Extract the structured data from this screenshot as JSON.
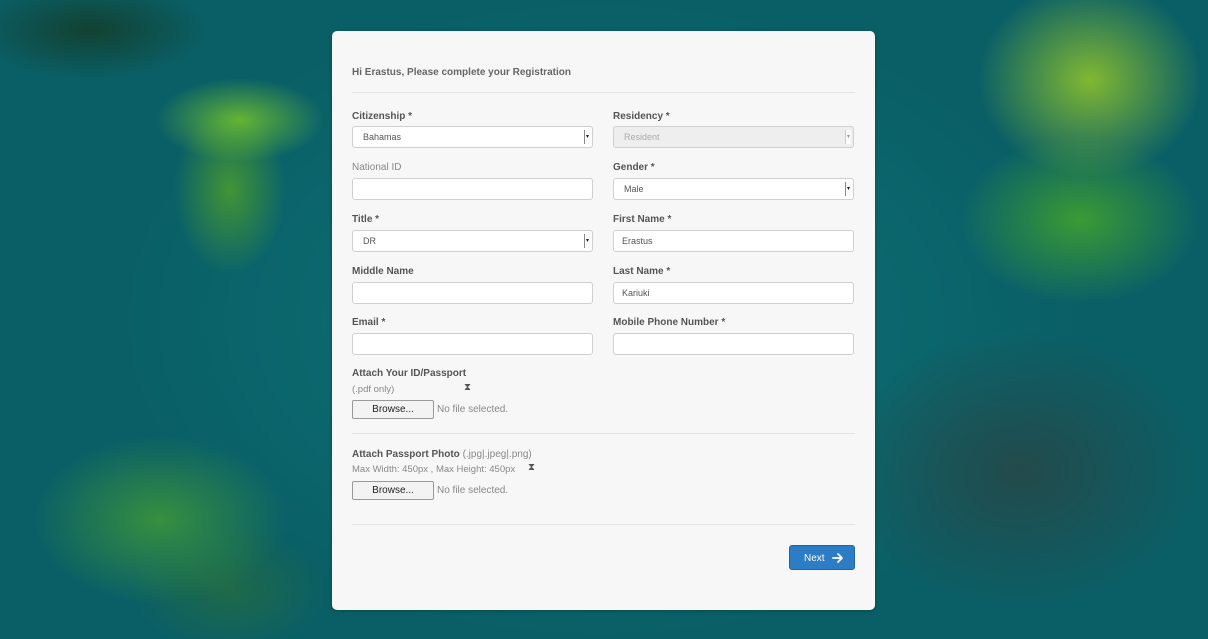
{
  "form": {
    "heading": "Hi Erastus, Please complete your Registration",
    "citizenship": {
      "label": "Citizenship *",
      "value": "Bahamas"
    },
    "residency": {
      "label": "Residency *",
      "value": "Resident"
    },
    "national_id": {
      "label": "National ID",
      "value": ""
    },
    "gender": {
      "label": "Gender *",
      "value": "Male"
    },
    "title": {
      "label": "Title *",
      "value": "DR"
    },
    "first_name": {
      "label": "First Name *",
      "value": "Erastus"
    },
    "middle_name": {
      "label": "Middle Name",
      "value": ""
    },
    "last_name": {
      "label": "Last Name *",
      "value": "Kariuki"
    },
    "email": {
      "label": "Email *",
      "value": ""
    },
    "mobile": {
      "label": "Mobile Phone Number *",
      "value": ""
    },
    "attach_id": {
      "label": "Attach Your ID/Passport",
      "hint": "(.pdf only)",
      "browse_label": "Browse...",
      "status": "No file selected."
    },
    "attach_photo": {
      "label": "Attach Passport Photo",
      "types": "(.jpg|.jpeg|.png)",
      "hint": "Max Width: 450px , Max Height: 450px",
      "browse_label": "Browse...",
      "status": "No file selected."
    },
    "next_label": "Next",
    "accent": "#2d7cc6"
  },
  "icons": {
    "dropdown": "chevron-down-icon",
    "hourglass": "hourglass-icon",
    "next": "arrow-right-icon"
  }
}
